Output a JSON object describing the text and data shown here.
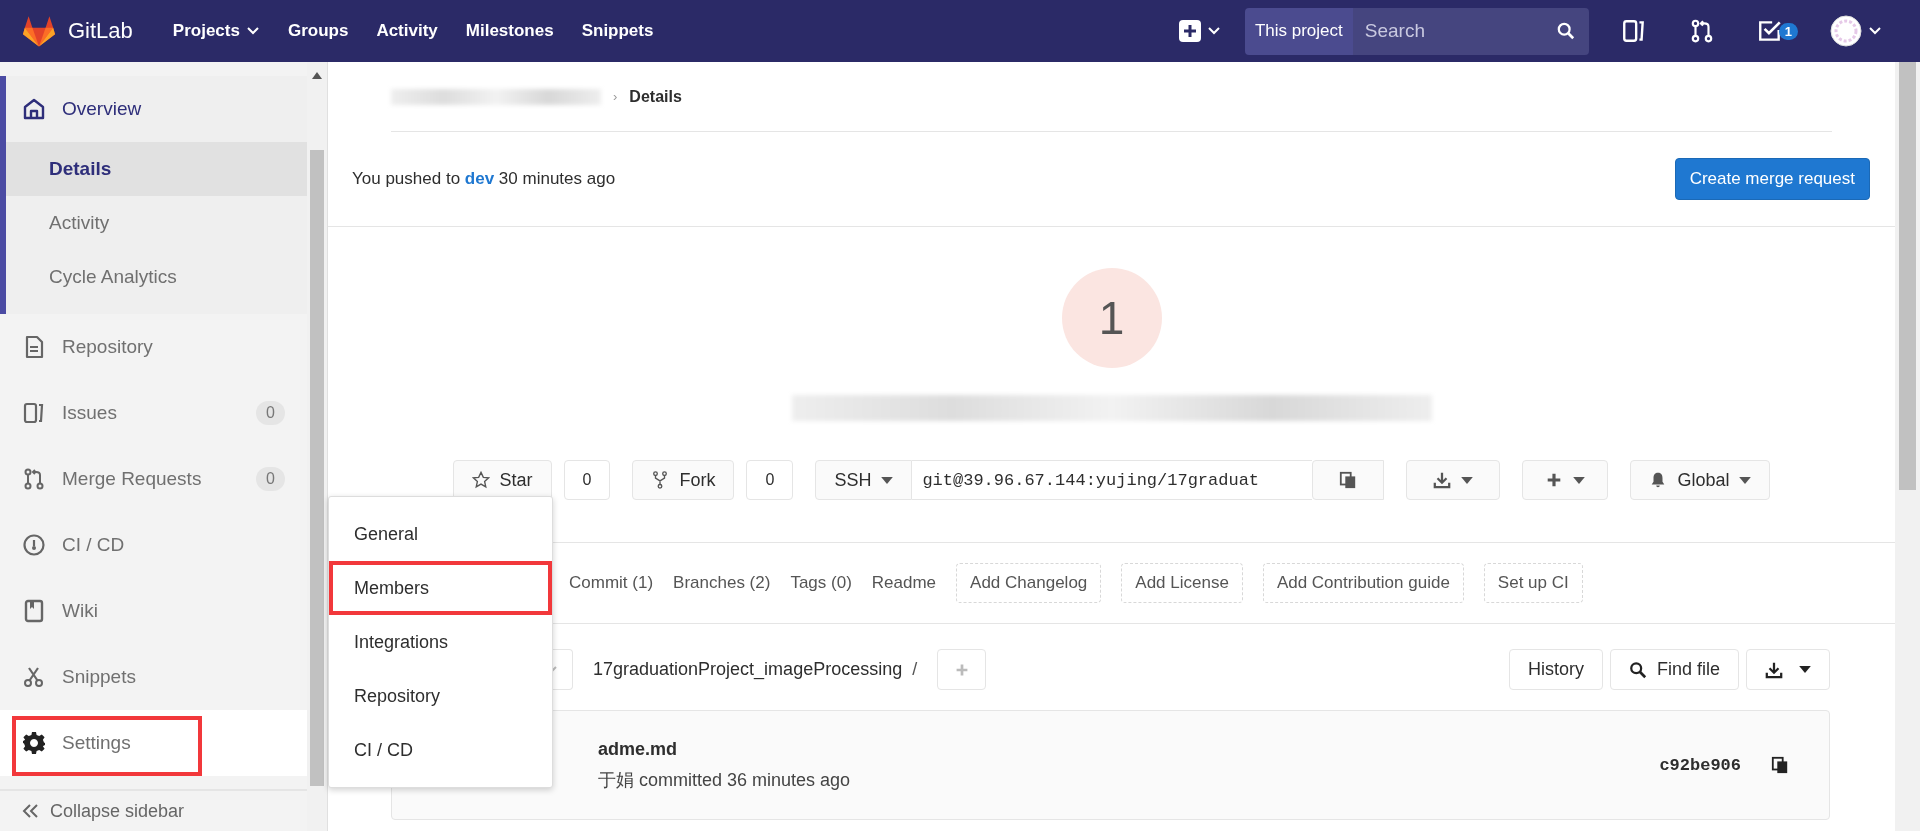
{
  "topbar": {
    "brand": "GitLab",
    "nav": [
      {
        "label": "Projects",
        "dropdown": true
      },
      {
        "label": "Groups",
        "dropdown": false
      },
      {
        "label": "Activity",
        "dropdown": false
      },
      {
        "label": "Milestones",
        "dropdown": false
      },
      {
        "label": "Snippets",
        "dropdown": false
      }
    ],
    "scope": "This project",
    "search": {
      "placeholder": "Search"
    },
    "todo_count": "1"
  },
  "sidebar": {
    "items": [
      {
        "label": "Overview",
        "selected": true,
        "hovered": false,
        "highlighted": false,
        "children": [
          {
            "label": "Details",
            "selected": true
          },
          {
            "label": "Activity",
            "selected": false
          },
          {
            "label": "Cycle Analytics",
            "selected": false
          }
        ]
      },
      {
        "label": "Repository",
        "selected": false,
        "hovered": false,
        "highlighted": false
      },
      {
        "label": "Issues",
        "badge": "0",
        "selected": false,
        "hovered": false,
        "highlighted": false
      },
      {
        "label": "Merge Requests",
        "badge": "0",
        "selected": false,
        "hovered": false,
        "highlighted": false
      },
      {
        "label": "CI / CD",
        "selected": false,
        "hovered": false,
        "highlighted": false
      },
      {
        "label": "Wiki",
        "selected": false,
        "hovered": false,
        "highlighted": false
      },
      {
        "label": "Snippets",
        "selected": false,
        "hovered": false,
        "highlighted": false
      },
      {
        "label": "Settings",
        "selected": false,
        "hovered": true,
        "highlighted": true
      }
    ],
    "collapse": "Collapse sidebar"
  },
  "settings_menu": [
    {
      "label": "General",
      "highlighted": false
    },
    {
      "label": "Members",
      "highlighted": true
    },
    {
      "label": "Integrations",
      "highlighted": false
    },
    {
      "label": "Repository",
      "highlighted": false
    },
    {
      "label": "CI / CD",
      "highlighted": false
    }
  ],
  "breadcrumb": {
    "separator": "›",
    "current": "Details"
  },
  "push_notice": {
    "before": "You pushed to",
    "branch": "dev",
    "after": "30 minutes ago",
    "button": "Create merge request"
  },
  "project": {
    "avatar_letter": "1",
    "star": {
      "label": "Star",
      "count": "0"
    },
    "fork": {
      "label": "Fork",
      "count": "0"
    },
    "clone": {
      "protocol": "SSH",
      "url": "git@39.96.67.144:yujing/17graduat"
    },
    "notification": "Global"
  },
  "tabs": [
    {
      "label": "Commit (1)",
      "kind": "link"
    },
    {
      "label": "Branches (2)",
      "kind": "link"
    },
    {
      "label": "Tags (0)",
      "kind": "link"
    },
    {
      "label": "Readme",
      "kind": "link"
    },
    {
      "label": "Add Changelog",
      "kind": "suggestion"
    },
    {
      "label": "Add License",
      "kind": "suggestion"
    },
    {
      "label": "Add Contribution guide",
      "kind": "suggestion"
    },
    {
      "label": "Set up CI",
      "kind": "suggestion"
    }
  ],
  "tree": {
    "path": "17graduationProject_imageProcessing",
    "separator": "/",
    "history": "History",
    "find": "Find file"
  },
  "last_commit": {
    "title": "adme.md",
    "author": "于娟",
    "meta": "committed 36 minutes ago",
    "sha": "c92be906"
  }
}
